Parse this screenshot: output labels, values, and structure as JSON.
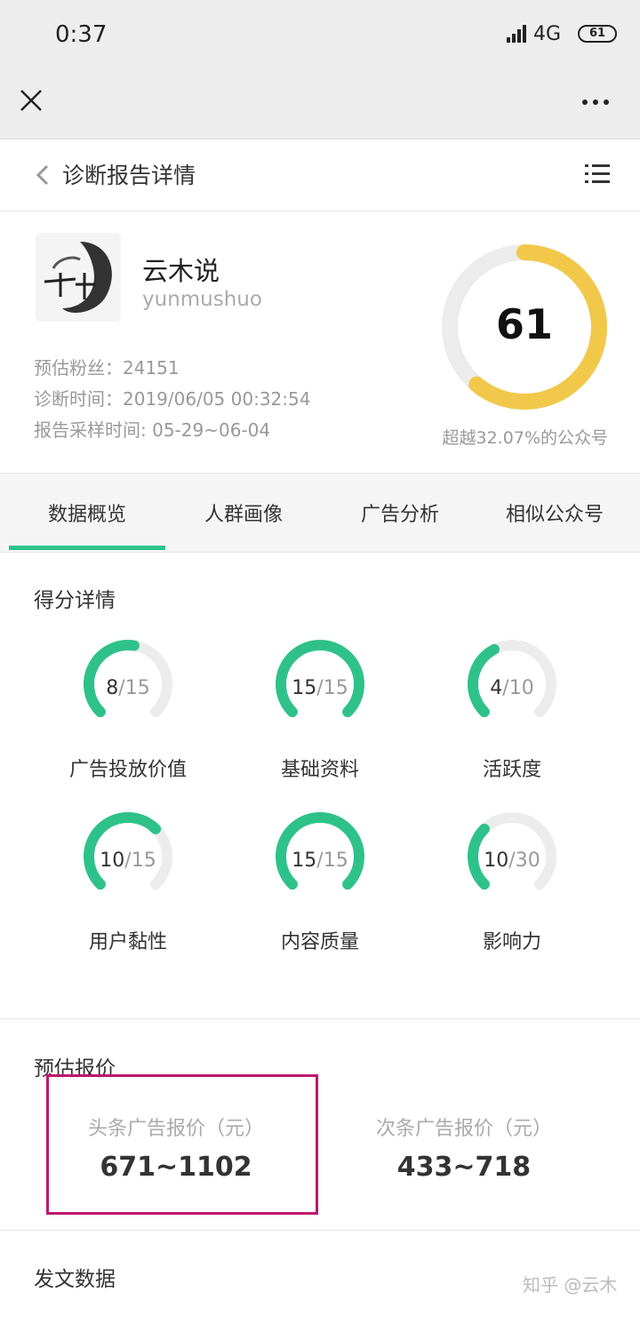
{
  "status_bar": {
    "time": "0:37",
    "network": "4G",
    "battery": "61"
  },
  "header": {
    "title": "诊断报告详情"
  },
  "profile": {
    "name": "云木说",
    "id": "yunmushuo",
    "fans": "预估粉丝：24151",
    "diag_time": "诊断时间：2019/06/05 00:32:54",
    "sample_time": "报告采样时间: 05-29~06-04",
    "score": "61",
    "score_fraction": 0.61,
    "beat": "超越32.07%的公众号"
  },
  "tabs": [
    "数据概览",
    "人群画像",
    "广告分析",
    "相似公众号"
  ],
  "score_details": {
    "title": "得分详情",
    "items": [
      {
        "label": "广告投放价值",
        "value": "8",
        "max": "/15"
      },
      {
        "label": "基础资料",
        "value": "15",
        "max": "/15"
      },
      {
        "label": "活跃度",
        "value": "4",
        "max": "/10"
      },
      {
        "label": "用户黏性",
        "value": "10",
        "max": "/15"
      },
      {
        "label": "内容质量",
        "value": "15",
        "max": "/15"
      },
      {
        "label": "影响力",
        "value": "10",
        "max": "/30"
      }
    ]
  },
  "quote": {
    "title": "预估报价",
    "headline_label": "头条广告报价（元）",
    "headline_value": "671~1102",
    "secondary_label": "次条广告报价（元）",
    "secondary_value": "433~718"
  },
  "posts": {
    "title": "发文数据"
  },
  "watermark": "知乎 @云木",
  "colors": {
    "accent": "#2ec28a",
    "ring": "#f1c84a",
    "highlight": "#c0166e"
  }
}
